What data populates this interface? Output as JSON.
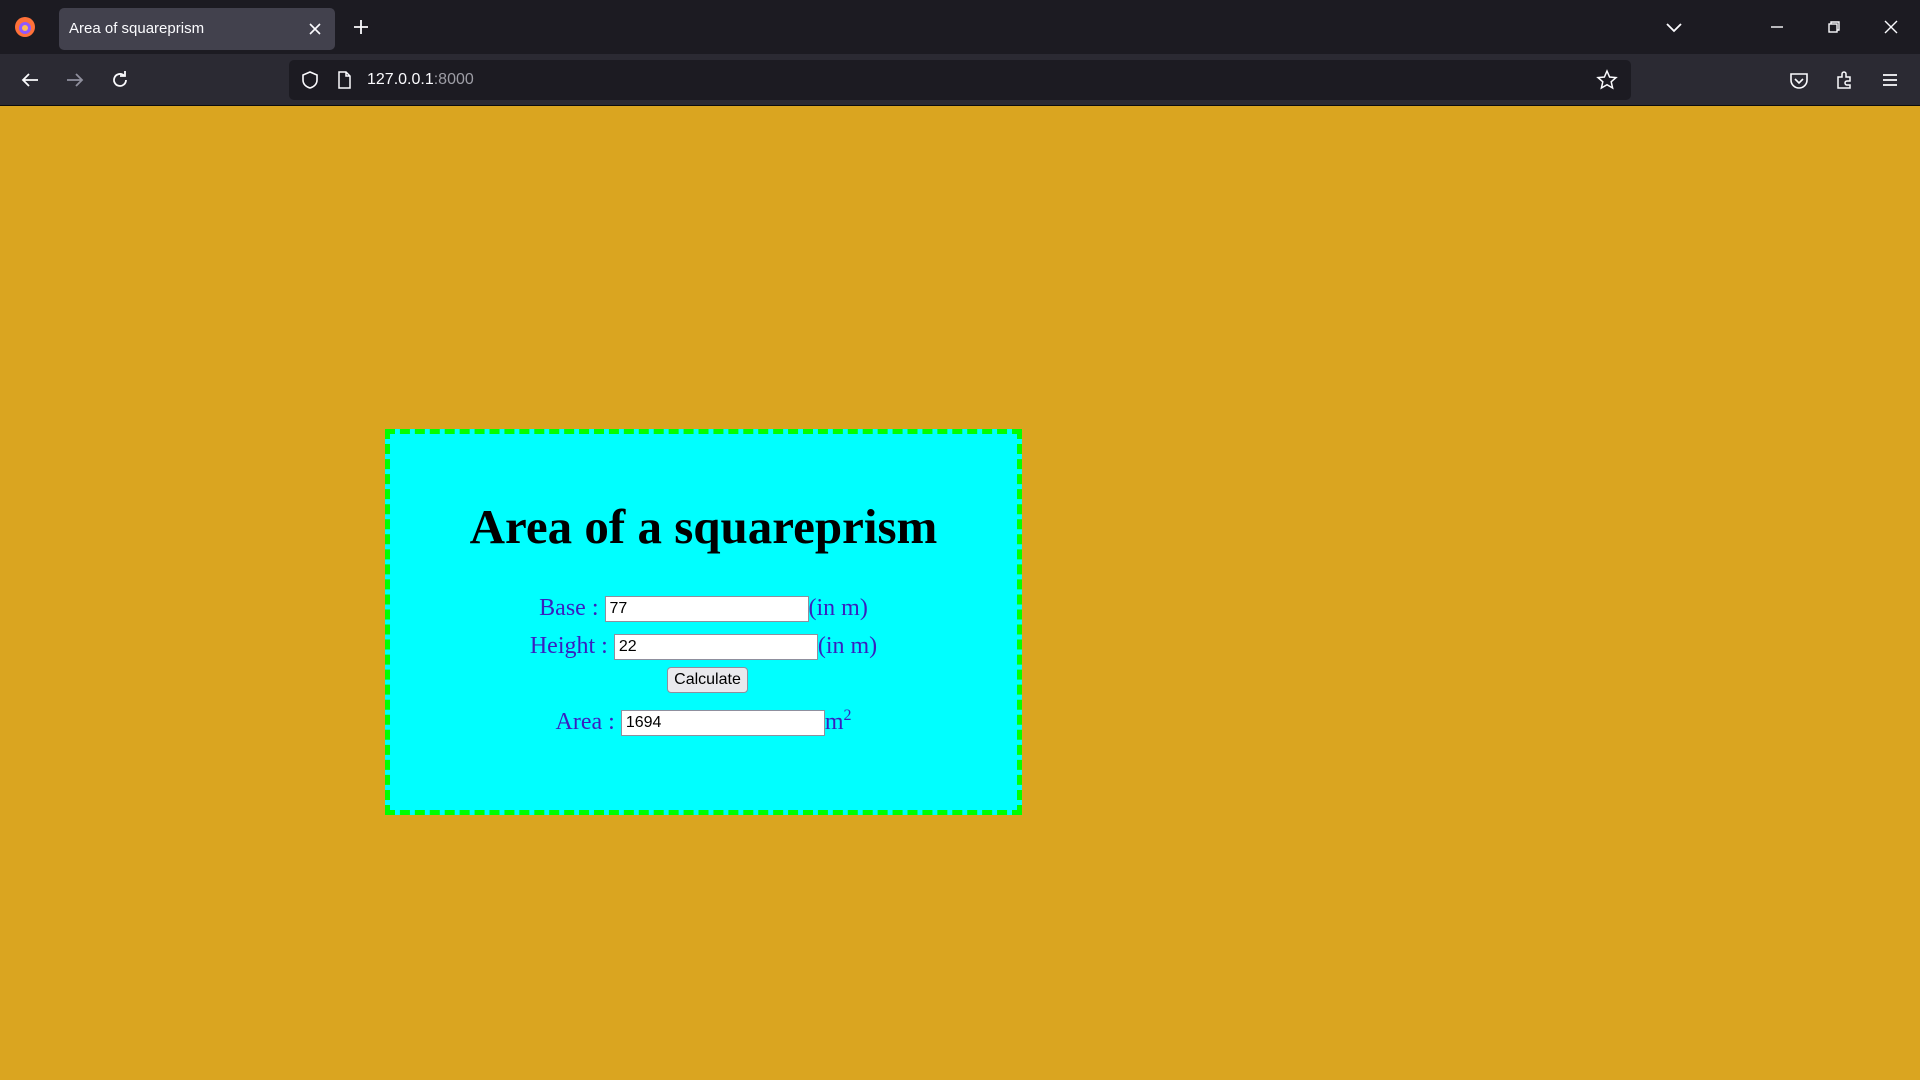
{
  "browser": {
    "tab_title": "Area of squareprism",
    "url_host": "127.0.0.1",
    "url_port": ":8000"
  },
  "page": {
    "heading": "Area of a squareprism",
    "base_label": "Base :",
    "base_value": "77",
    "base_unit": "(in m)",
    "height_label": "Height :",
    "height_value": "22",
    "height_unit": "(in m)",
    "calculate_label": "Calculate",
    "area_label": "Area :",
    "area_value": "1694",
    "area_unit": "m",
    "area_unit_exponent": "2"
  },
  "colors": {
    "page_background": "#daa520",
    "card_background": "#00ffff",
    "card_border": "#00ff00",
    "label_color": "#3a1fbf"
  }
}
